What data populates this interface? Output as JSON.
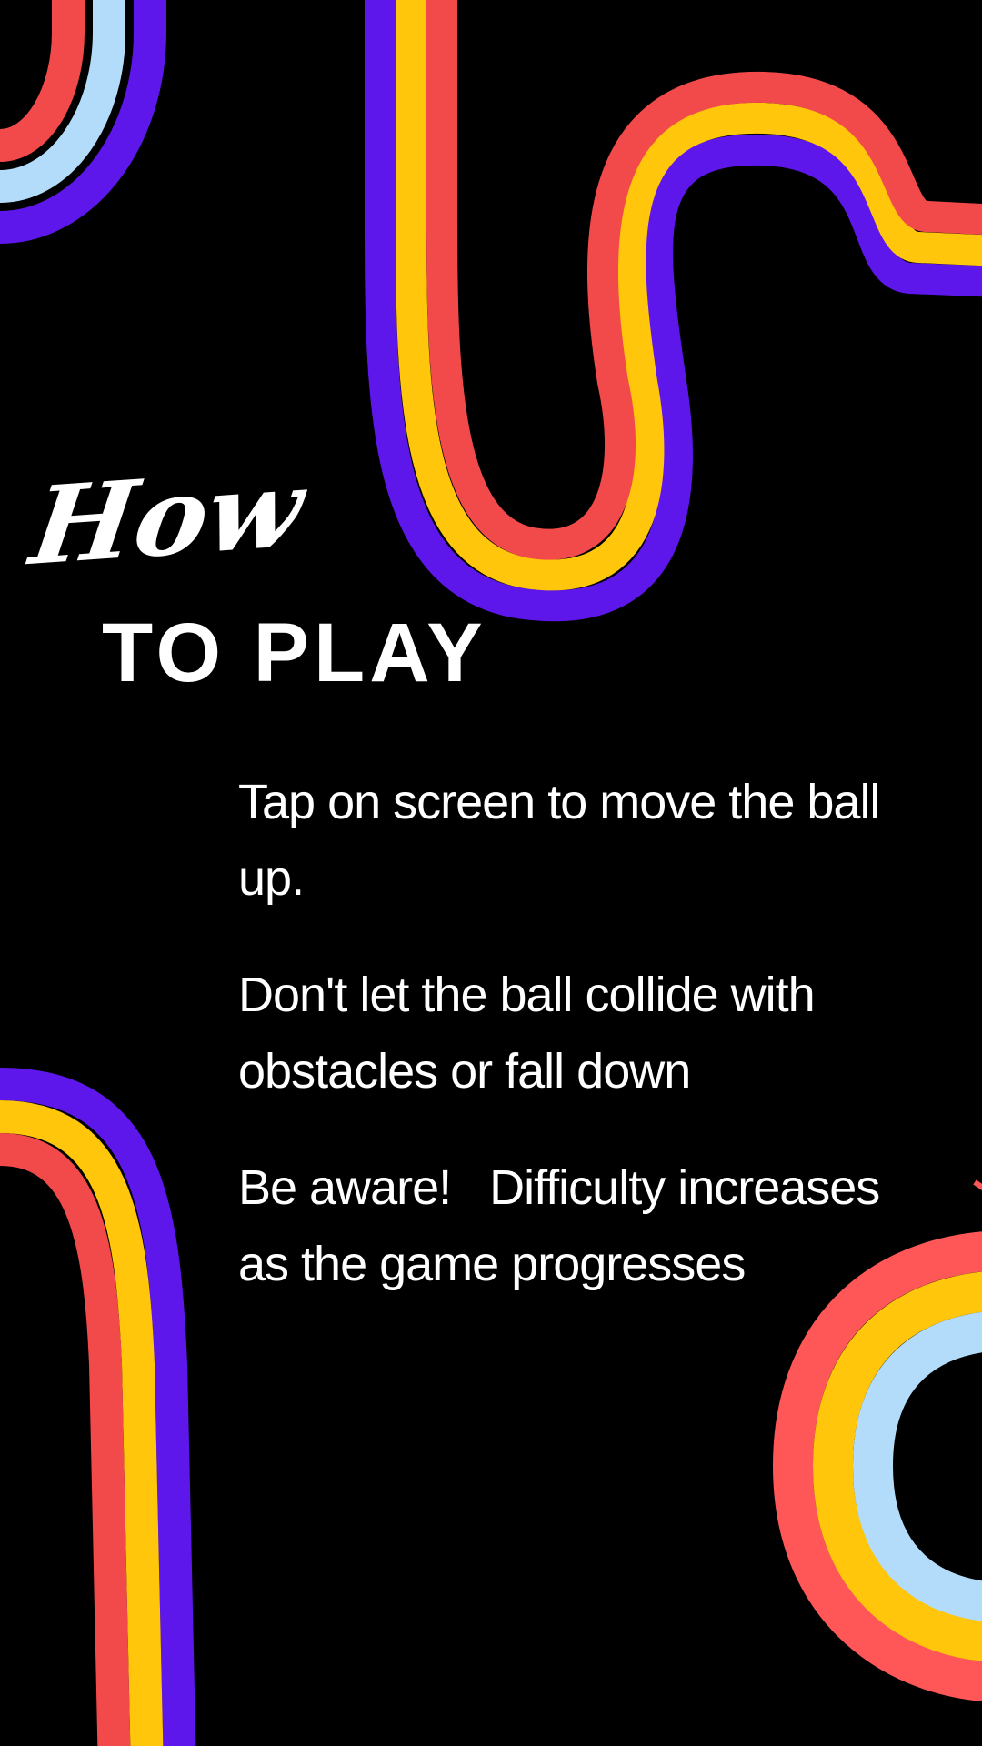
{
  "colors": {
    "background": "#000000",
    "text": "#ffffff",
    "stripe_purple": "#5e17eb",
    "stripe_yellow": "#ffc60b",
    "stripe_red": "#f24a4a",
    "stripe_coral": "#ff5757",
    "stripe_light_blue": "#b3dcfa"
  },
  "title": {
    "script": "How",
    "main": "TO PLAY"
  },
  "instructions": [
    "Tap on screen to move the ball up.",
    "Don't let the ball collide with obstacles or fall down",
    "Be aware!   Difficulty increases as the game progresses"
  ]
}
